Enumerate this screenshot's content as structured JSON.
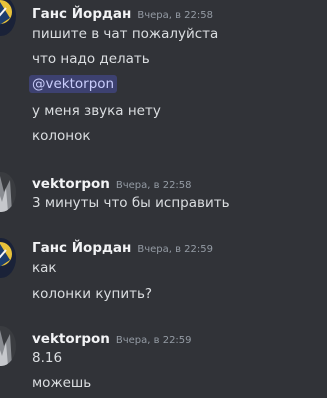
{
  "messages": [
    {
      "username": "Ганс Йордан",
      "timestamp": "Вчера, в 22:58",
      "lines": [
        "пишите в чат пожалуйста",
        "что надо делать",
        "@vektorpon",
        "у меня звука нету",
        "колонок"
      ]
    },
    {
      "username": "vektorpon",
      "timestamp": "Вчера, в 22:58",
      "lines": [
        "3 минуты что бы исправить"
      ]
    },
    {
      "username": "Ганс Йордан",
      "timestamp": "Вчера, в 22:59",
      "lines": [
        "как",
        "колонки купить?"
      ]
    },
    {
      "username": "vektorpon",
      "timestamp": "Вчера, в 22:59",
      "lines": [
        "8.16",
        "можешь"
      ]
    }
  ],
  "colors": {
    "background": "#313338",
    "username": "#f2f3f5",
    "timestamp": "#949ba4",
    "text": "#dbdee1",
    "mention_bg": "#5865f24d",
    "mention_text": "#c9cdfb"
  }
}
